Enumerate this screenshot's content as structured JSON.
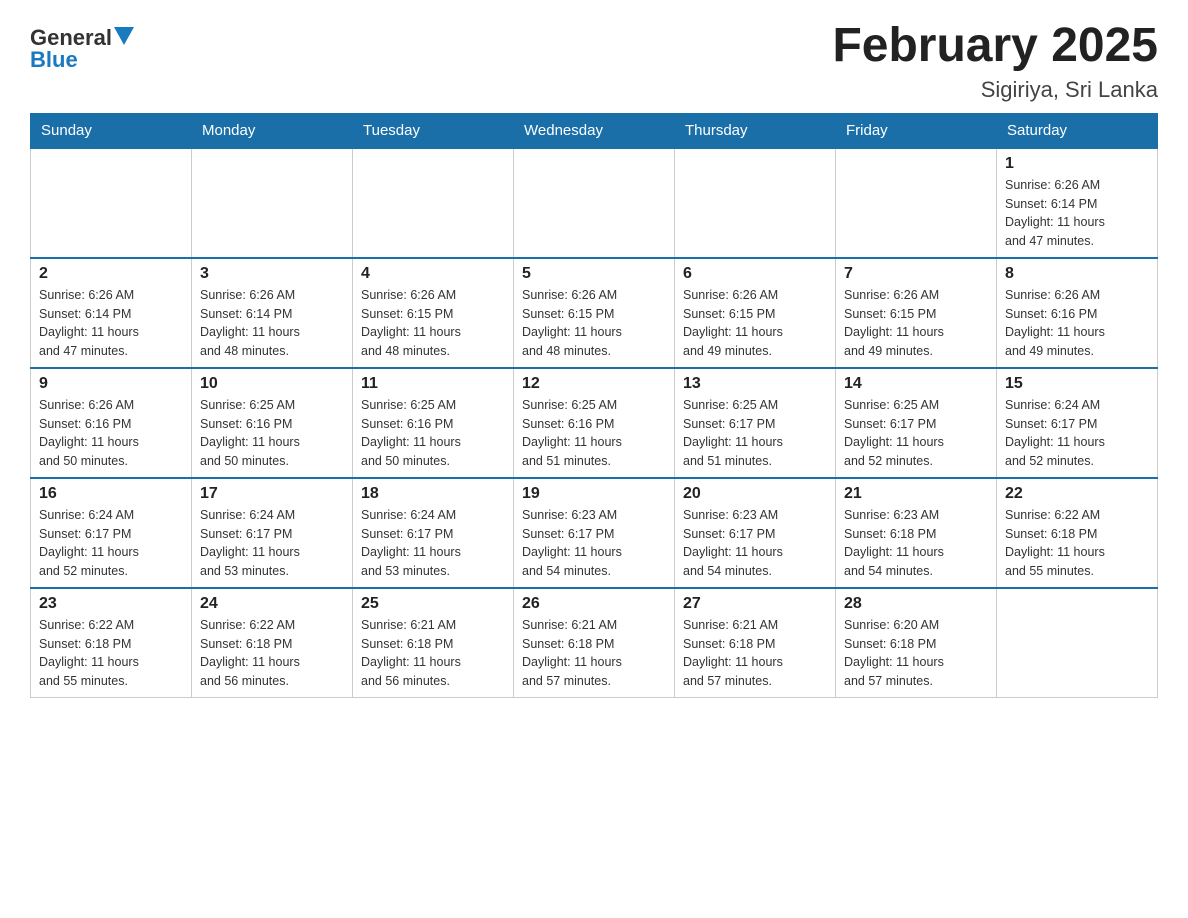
{
  "header": {
    "logo_text_black": "General",
    "logo_text_blue": "Blue",
    "month_title": "February 2025",
    "location": "Sigiriya, Sri Lanka"
  },
  "days_of_week": [
    "Sunday",
    "Monday",
    "Tuesday",
    "Wednesday",
    "Thursday",
    "Friday",
    "Saturday"
  ],
  "weeks": [
    {
      "days": [
        {
          "num": "",
          "info": ""
        },
        {
          "num": "",
          "info": ""
        },
        {
          "num": "",
          "info": ""
        },
        {
          "num": "",
          "info": ""
        },
        {
          "num": "",
          "info": ""
        },
        {
          "num": "",
          "info": ""
        },
        {
          "num": "1",
          "info": "Sunrise: 6:26 AM\nSunset: 6:14 PM\nDaylight: 11 hours\nand 47 minutes."
        }
      ]
    },
    {
      "days": [
        {
          "num": "2",
          "info": "Sunrise: 6:26 AM\nSunset: 6:14 PM\nDaylight: 11 hours\nand 47 minutes."
        },
        {
          "num": "3",
          "info": "Sunrise: 6:26 AM\nSunset: 6:14 PM\nDaylight: 11 hours\nand 48 minutes."
        },
        {
          "num": "4",
          "info": "Sunrise: 6:26 AM\nSunset: 6:15 PM\nDaylight: 11 hours\nand 48 minutes."
        },
        {
          "num": "5",
          "info": "Sunrise: 6:26 AM\nSunset: 6:15 PM\nDaylight: 11 hours\nand 48 minutes."
        },
        {
          "num": "6",
          "info": "Sunrise: 6:26 AM\nSunset: 6:15 PM\nDaylight: 11 hours\nand 49 minutes."
        },
        {
          "num": "7",
          "info": "Sunrise: 6:26 AM\nSunset: 6:15 PM\nDaylight: 11 hours\nand 49 minutes."
        },
        {
          "num": "8",
          "info": "Sunrise: 6:26 AM\nSunset: 6:16 PM\nDaylight: 11 hours\nand 49 minutes."
        }
      ]
    },
    {
      "days": [
        {
          "num": "9",
          "info": "Sunrise: 6:26 AM\nSunset: 6:16 PM\nDaylight: 11 hours\nand 50 minutes."
        },
        {
          "num": "10",
          "info": "Sunrise: 6:25 AM\nSunset: 6:16 PM\nDaylight: 11 hours\nand 50 minutes."
        },
        {
          "num": "11",
          "info": "Sunrise: 6:25 AM\nSunset: 6:16 PM\nDaylight: 11 hours\nand 50 minutes."
        },
        {
          "num": "12",
          "info": "Sunrise: 6:25 AM\nSunset: 6:16 PM\nDaylight: 11 hours\nand 51 minutes."
        },
        {
          "num": "13",
          "info": "Sunrise: 6:25 AM\nSunset: 6:17 PM\nDaylight: 11 hours\nand 51 minutes."
        },
        {
          "num": "14",
          "info": "Sunrise: 6:25 AM\nSunset: 6:17 PM\nDaylight: 11 hours\nand 52 minutes."
        },
        {
          "num": "15",
          "info": "Sunrise: 6:24 AM\nSunset: 6:17 PM\nDaylight: 11 hours\nand 52 minutes."
        }
      ]
    },
    {
      "days": [
        {
          "num": "16",
          "info": "Sunrise: 6:24 AM\nSunset: 6:17 PM\nDaylight: 11 hours\nand 52 minutes."
        },
        {
          "num": "17",
          "info": "Sunrise: 6:24 AM\nSunset: 6:17 PM\nDaylight: 11 hours\nand 53 minutes."
        },
        {
          "num": "18",
          "info": "Sunrise: 6:24 AM\nSunset: 6:17 PM\nDaylight: 11 hours\nand 53 minutes."
        },
        {
          "num": "19",
          "info": "Sunrise: 6:23 AM\nSunset: 6:17 PM\nDaylight: 11 hours\nand 54 minutes."
        },
        {
          "num": "20",
          "info": "Sunrise: 6:23 AM\nSunset: 6:17 PM\nDaylight: 11 hours\nand 54 minutes."
        },
        {
          "num": "21",
          "info": "Sunrise: 6:23 AM\nSunset: 6:18 PM\nDaylight: 11 hours\nand 54 minutes."
        },
        {
          "num": "22",
          "info": "Sunrise: 6:22 AM\nSunset: 6:18 PM\nDaylight: 11 hours\nand 55 minutes."
        }
      ]
    },
    {
      "days": [
        {
          "num": "23",
          "info": "Sunrise: 6:22 AM\nSunset: 6:18 PM\nDaylight: 11 hours\nand 55 minutes."
        },
        {
          "num": "24",
          "info": "Sunrise: 6:22 AM\nSunset: 6:18 PM\nDaylight: 11 hours\nand 56 minutes."
        },
        {
          "num": "25",
          "info": "Sunrise: 6:21 AM\nSunset: 6:18 PM\nDaylight: 11 hours\nand 56 minutes."
        },
        {
          "num": "26",
          "info": "Sunrise: 6:21 AM\nSunset: 6:18 PM\nDaylight: 11 hours\nand 57 minutes."
        },
        {
          "num": "27",
          "info": "Sunrise: 6:21 AM\nSunset: 6:18 PM\nDaylight: 11 hours\nand 57 minutes."
        },
        {
          "num": "28",
          "info": "Sunrise: 6:20 AM\nSunset: 6:18 PM\nDaylight: 11 hours\nand 57 minutes."
        },
        {
          "num": "",
          "info": ""
        }
      ]
    }
  ]
}
